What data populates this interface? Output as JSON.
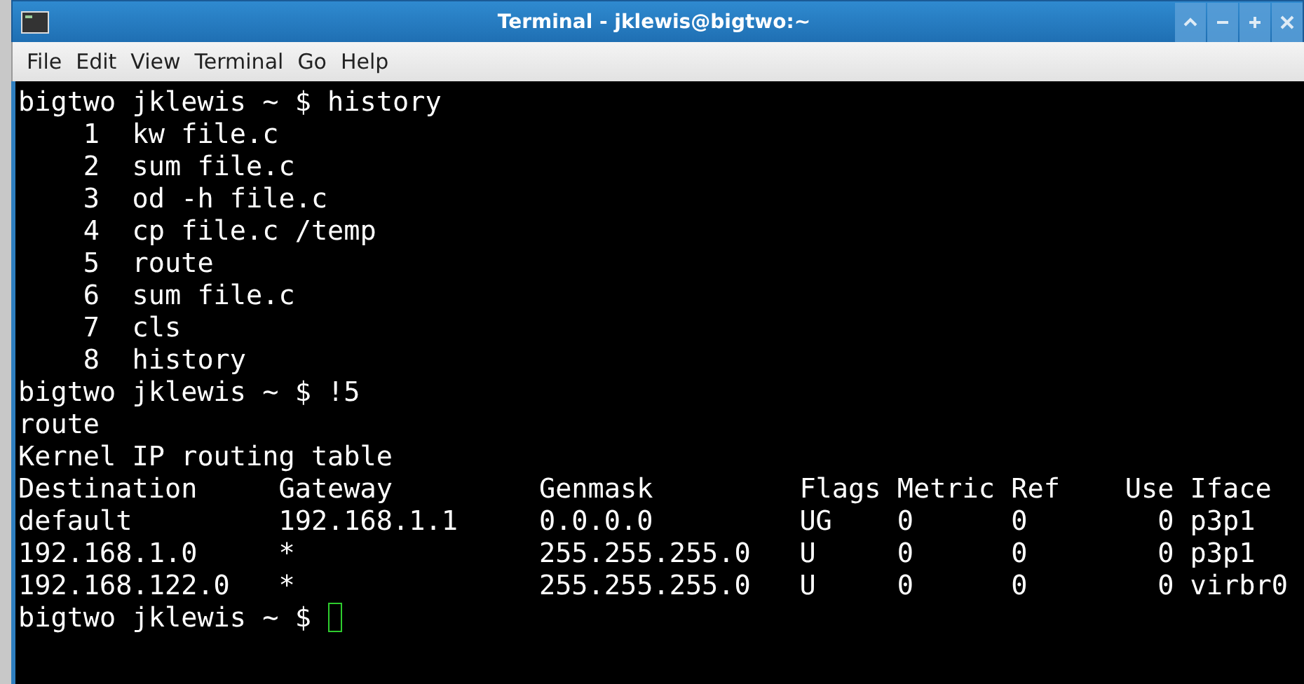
{
  "window": {
    "title": "Terminal - jklewis@bigtwo:~"
  },
  "menu": [
    "File",
    "Edit",
    "View",
    "Terminal",
    "Go",
    "Help"
  ],
  "terminal": {
    "lines": [
      "bigtwo jklewis ~ $ history",
      "    1  kw file.c",
      "    2  sum file.c",
      "    3  od -h file.c",
      "    4  cp file.c /temp",
      "    5  route",
      "    6  sum file.c",
      "    7  cls",
      "    8  history",
      "bigtwo jklewis ~ $ !5",
      "route",
      "Kernel IP routing table",
      "Destination     Gateway         Genmask         Flags Metric Ref    Use Iface",
      "default         192.168.1.1     0.0.0.0         UG    0      0        0 p3p1",
      "192.168.1.0     *               255.255.255.0   U     0      0        0 p3p1",
      "192.168.122.0   *               255.255.255.0   U     0      0        0 virbr0"
    ],
    "prompt": "bigtwo jklewis ~ $ "
  }
}
